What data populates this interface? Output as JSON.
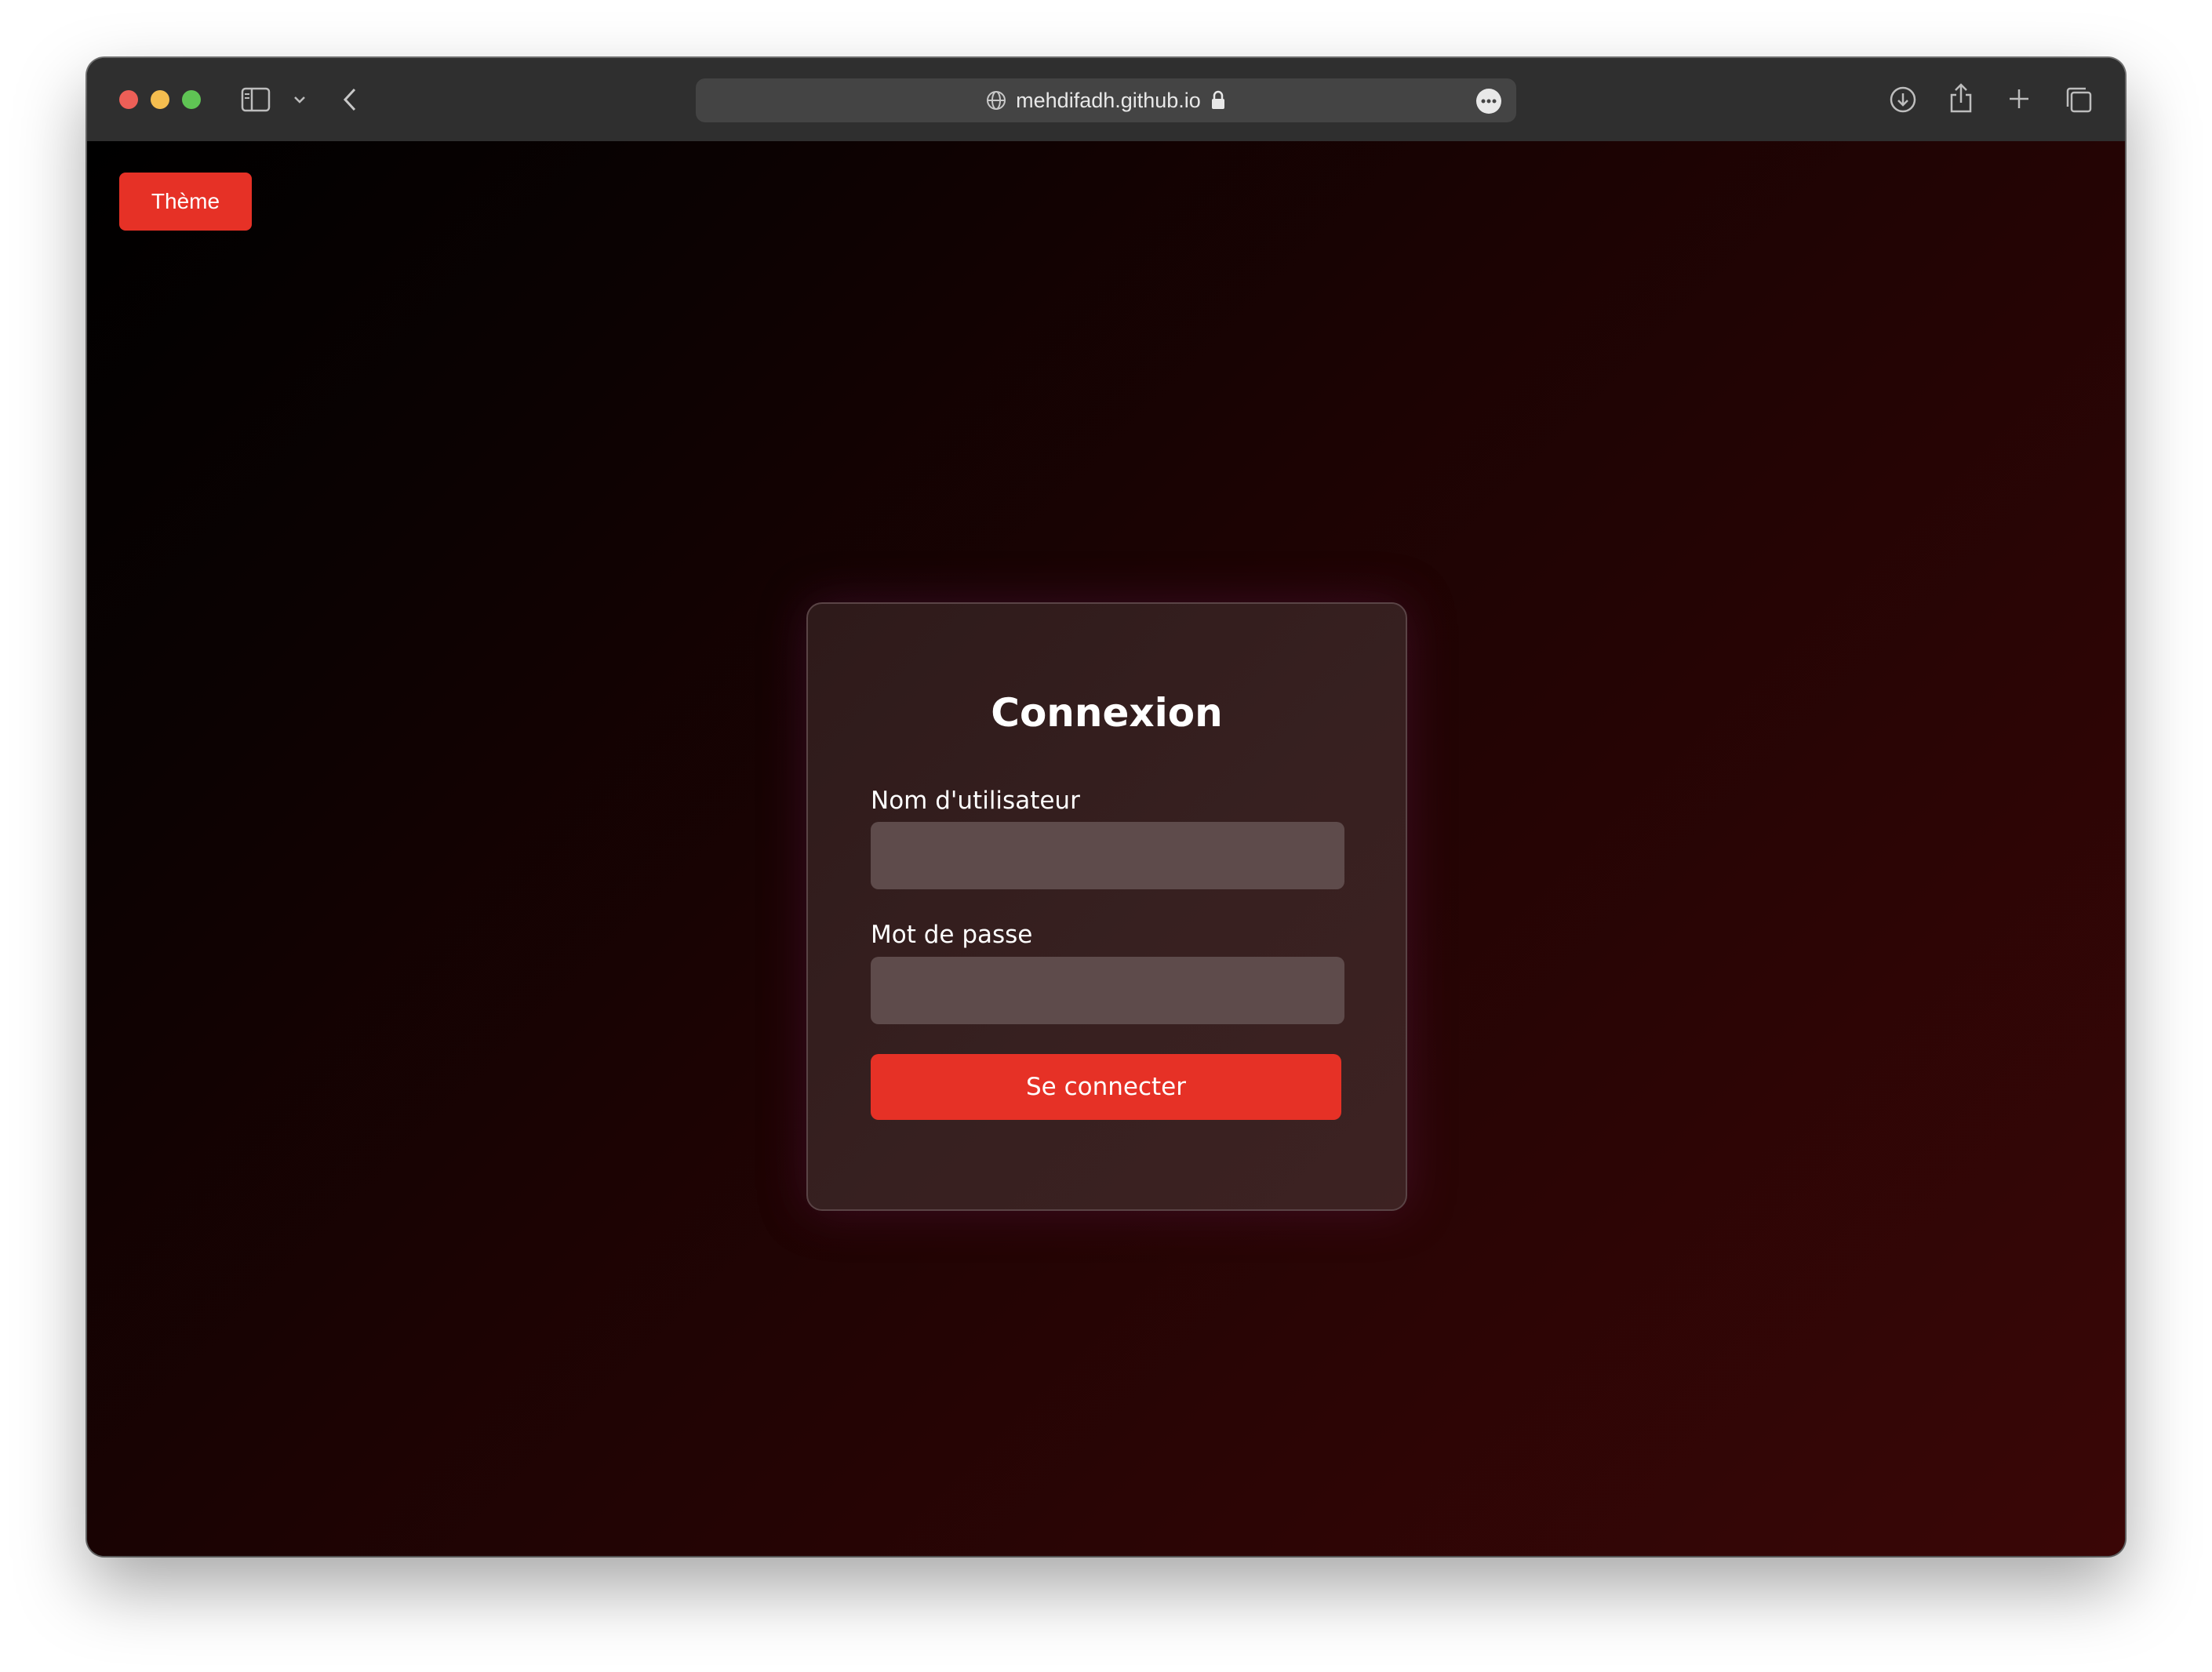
{
  "browser": {
    "address": "mehdifadh.github.io",
    "icons": [
      "sidebar-icon",
      "chevron-down-icon",
      "back-icon",
      "globe-icon",
      "lock-icon",
      "more-icon",
      "download-icon",
      "share-icon",
      "new-tab-icon",
      "tabs-icon"
    ]
  },
  "page": {
    "theme_button": "Thème",
    "login": {
      "title": "Connexion",
      "username_label": "Nom d'utilisateur",
      "username_value": "",
      "password_label": "Mot de passe",
      "password_value": "",
      "submit_label": "Se connecter"
    }
  },
  "colors": {
    "accent": "#e63126",
    "card_background": "#372020",
    "input_background": "#5e4b4b",
    "toolbar": "#2f2f2f"
  }
}
